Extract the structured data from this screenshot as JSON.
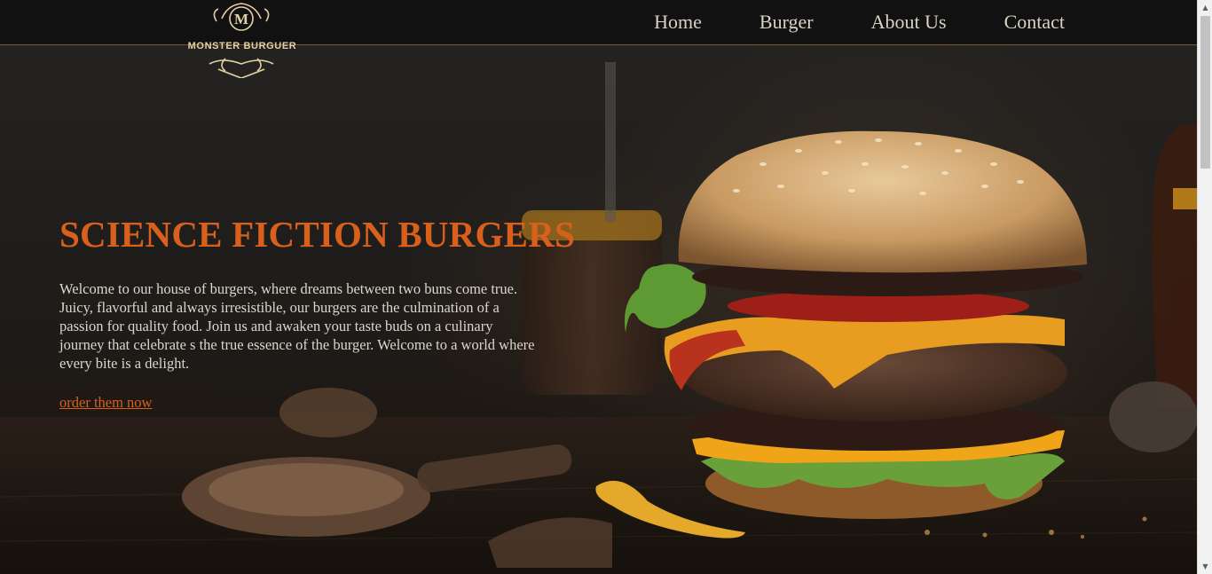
{
  "brand": {
    "logo_letter": "M",
    "logo_text": "MONSTER BURGUER"
  },
  "nav": {
    "items": [
      {
        "label": "Home"
      },
      {
        "label": "Burger"
      },
      {
        "label": "About Us"
      },
      {
        "label": "Contact"
      }
    ]
  },
  "hero": {
    "title": "SCIENCE FICTION BURGERS",
    "body": "Welcome to our house of burgers, where dreams between two buns come true. Juicy, flavorful and always irresistible, our burgers are the culmination of a passion for quality food. Join us and awaken your taste buds on a culinary journey that celebrate s the true essence of the burger. Welcome to a world where every bite is a delight.",
    "cta": "order them now"
  },
  "colors": {
    "accent": "#d9601c",
    "header_bg": "#111111",
    "logo_gold": "#e6d1a6",
    "nav_text": "#d9d2c6"
  },
  "icons": {
    "scroll_up": "chevron-up-icon",
    "scroll_down": "chevron-down-icon"
  }
}
